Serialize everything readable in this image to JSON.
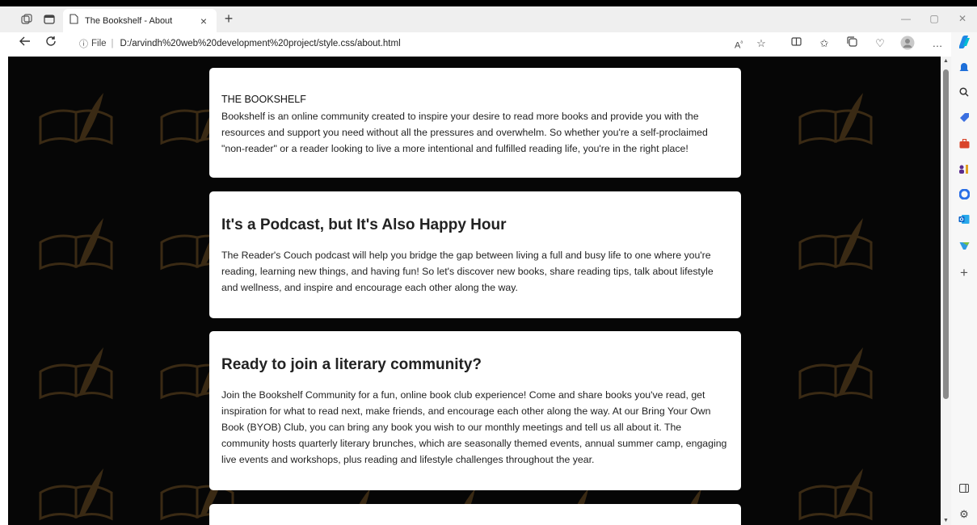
{
  "browser": {
    "tab_title": "The Bookshelf - About",
    "tab_close": "×",
    "new_tab": "+",
    "url_info": "ⓘ",
    "url_scheme": "File",
    "url_separator": "|",
    "url": "D:/arvindh%20web%20development%20project/style.css/about.html",
    "minimize": "—",
    "restore": "▢",
    "close": "✕",
    "more": "…",
    "add": "+"
  },
  "cards": [
    {
      "small_title": "THE BOOKSHELF",
      "text": "Bookshelf is an online community created to inspire your desire to read more books and provide you with the resources and support you need without all the pressures and overwhelm. So whether you're a self-proclaimed \"non-reader\" or a reader looking to live a more intentional and fulfilled reading life, you're in the right place!"
    },
    {
      "heading": "It's a Podcast, but It's Also Happy Hour",
      "text": "The Reader's Couch podcast will help you bridge the gap between living a full and busy life to one where you're reading, learning new things, and having fun! So let's discover new books, share reading tips, talk about lifestyle and wellness, and inspire and encourage each other along the way."
    },
    {
      "heading": "Ready to join a literary community?",
      "text": "Join the Bookshelf Community for a fun, online book club experience! Come and share books you've read, get inspiration for what to read next, make friends, and encourage each other along the way. At our Bring Your Own Book (BYOB) Club, you can bring any book you wish to our monthly meetings and tell us all about it. The community hosts quarterly literary brunches, which are seasonally themed events, annual summer camp, engaging live events and workshops, plus reading and lifestyle challenges throughout the year."
    }
  ],
  "colors": {
    "page_background": "#060606",
    "card_background": "#ffffff",
    "motif": "#3a2a14",
    "copilot_blue": "#1e88e5"
  },
  "icons": [
    "workspaces-icon",
    "tab-actions-icon",
    "page-icon",
    "back-arrow-icon",
    "refresh-icon",
    "read-aloud-icon",
    "favorite-star-icon",
    "split-screen-icon",
    "favorites-icon",
    "collections-icon",
    "extensions-icon",
    "profile-icon",
    "copilot-icon",
    "bell-icon",
    "search-icon",
    "tag-icon",
    "toolbox-icon",
    "people-icon",
    "office-icon",
    "outlook-icon",
    "designer-icon",
    "add-icon",
    "sidebar-toggle-icon",
    "settings-icon"
  ]
}
